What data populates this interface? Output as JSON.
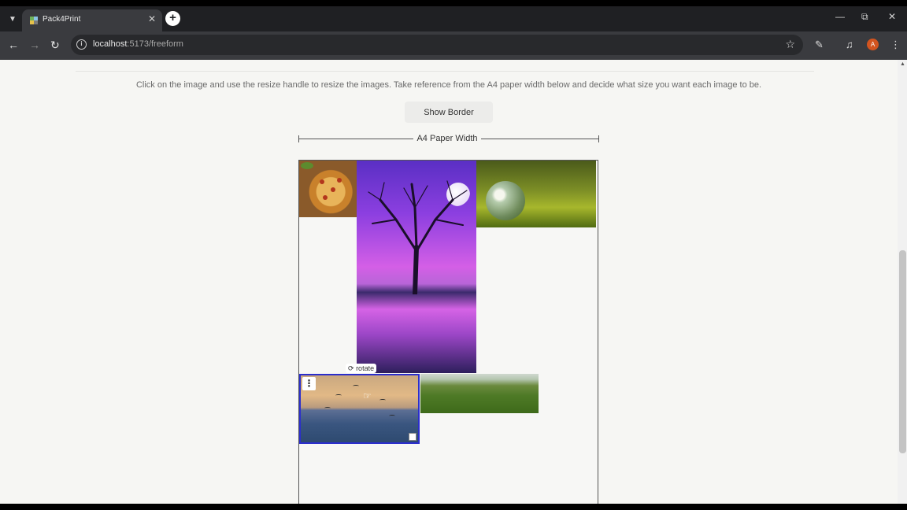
{
  "browser": {
    "tab_title": "Pack4Print",
    "url_host": "localhost",
    "url_path": ":5173/freeform",
    "profile_initial": "A"
  },
  "page": {
    "instructions": "Click on the image and use the resize handle to resize the images. Take reference from the A4 paper width below and decide what size you want each image to be.",
    "show_border_label": "Show Border",
    "ruler_label": "A4 Paper Width",
    "rotate_label": "rotate"
  },
  "images": [
    {
      "name": "pizza",
      "selected": false
    },
    {
      "name": "purple-tree-moon",
      "selected": false
    },
    {
      "name": "crystal-globe-moss",
      "selected": false
    },
    {
      "name": "birds-over-ocean",
      "selected": true
    },
    {
      "name": "green-hills",
      "selected": false
    }
  ],
  "colors": {
    "selection_border": "#2b2ecc",
    "avatar": "#d3541f",
    "browser_chrome": "#3a3b3f"
  },
  "icons": [
    "tab-list-icon",
    "favicon-icon",
    "close-icon",
    "new-tab-icon",
    "minimize-icon",
    "restore-icon",
    "back-icon",
    "forward-icon",
    "reload-icon",
    "site-info-icon",
    "star-icon",
    "extensions-icon",
    "media-icon",
    "kebab-menu-icon",
    "rotate-icon",
    "resize-handle-icon"
  ]
}
